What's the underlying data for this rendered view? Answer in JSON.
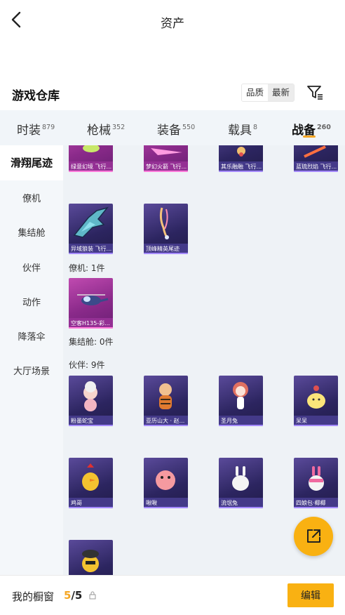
{
  "header": {
    "title": "资产"
  },
  "warehouse": {
    "title": "游戏仓库",
    "sort_options": [
      "品质",
      "最新"
    ],
    "active_sort": "最新"
  },
  "tabs": [
    {
      "label": "时装",
      "count": "879"
    },
    {
      "label": "枪械",
      "count": "352"
    },
    {
      "label": "装备",
      "count": "550"
    },
    {
      "label": "载具",
      "count": "8"
    },
    {
      "label": "战备",
      "count": "260",
      "active": true
    }
  ],
  "sidebar": {
    "items": [
      "滑翔尾迹",
      "僚机",
      "集结舱",
      "伙伴",
      "动作",
      "降落伞",
      "大厅场景"
    ],
    "active": "滑翔尾迹"
  },
  "groups": {
    "trails_top": [
      "绿意幻境 飞行...",
      "梦幻火箭 飞行...",
      "其乐融融 飞行...",
      "蓝琉烈焰 飞行..."
    ],
    "trails_row2": [
      "异域狼装 飞行...",
      "顶峰精英尾迹"
    ],
    "wingman_label": "僚机: 1件",
    "wingman": [
      "空客H135-彩..."
    ],
    "capsule_label": "集结舱: 0件",
    "partner_label": "伙伴: 9件",
    "partners": [
      "粉墨蛇宝",
      "亚历山大 · 赵...",
      "圣月兔",
      "呆呆",
      "鸡哥",
      "啾啾",
      "流氓兔",
      "四娘包·椰椰",
      ""
    ]
  },
  "footer": {
    "label": "我的橱窗",
    "current": "5",
    "total": "/5",
    "edit_label": "编辑"
  },
  "colors": {
    "accent": "#f9b112",
    "card_purple": "#2c2560",
    "card_magenta": "#8a2a8a"
  }
}
